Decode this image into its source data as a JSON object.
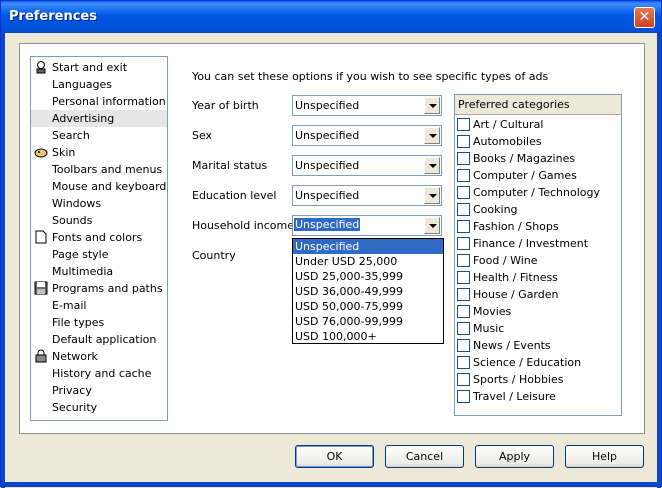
{
  "window": {
    "title": "Preferences"
  },
  "sidebar": {
    "items": [
      {
        "label": "Start and exit",
        "icon": "user-icon"
      },
      {
        "label": "Languages"
      },
      {
        "label": "Personal information"
      },
      {
        "label": "Advertising",
        "selected": true
      },
      {
        "label": "Search"
      },
      {
        "label": "Skin",
        "icon": "skin-icon"
      },
      {
        "label": "Toolbars and menus"
      },
      {
        "label": "Mouse and keyboard"
      },
      {
        "label": "Windows"
      },
      {
        "label": "Sounds"
      },
      {
        "label": "Fonts and colors",
        "icon": "document-icon"
      },
      {
        "label": "Page style"
      },
      {
        "label": "Multimedia"
      },
      {
        "label": "Programs and paths",
        "icon": "floppy-icon"
      },
      {
        "label": "E-mail"
      },
      {
        "label": "File types"
      },
      {
        "label": "Default application"
      },
      {
        "label": "Network",
        "icon": "lock-icon"
      },
      {
        "label": "History and cache"
      },
      {
        "label": "Privacy"
      },
      {
        "label": "Security"
      }
    ]
  },
  "intro": "You can set these options if you wish to see specific types of ads",
  "form": {
    "birth_label": "Year of birth",
    "birth_value": "Unspecified",
    "sex_label": "Sex",
    "sex_value": "Unspecified",
    "marital_label": "Marital status",
    "marital_value": "Unspecified",
    "education_label": "Education level",
    "education_value": "Unspecified",
    "income_label": "Household income",
    "income_value": "Unspecified",
    "country_label": "Country"
  },
  "income_options": [
    "Unspecified",
    "Under USD 25,000",
    "USD 25,000-35,999",
    "USD 36,000-49,999",
    "USD 50,000-75,999",
    "USD 76,000-99,999",
    "USD 100,000+"
  ],
  "categories": {
    "header": "Preferred categories",
    "items": [
      "Art / Cultural",
      "Automobiles",
      "Books / Magazines",
      "Computer / Games",
      "Computer / Technology",
      "Cooking",
      "Fashion / Shops",
      "Finance / Investment",
      "Food / Wine",
      "Health / Fitness",
      "House / Garden",
      "Movies",
      "Music",
      "News / Events",
      "Science / Education",
      "Sports / Hobbies",
      "Travel / Leisure"
    ]
  },
  "buttons": {
    "ok": "OK",
    "cancel": "Cancel",
    "apply": "Apply",
    "help": "Help"
  }
}
